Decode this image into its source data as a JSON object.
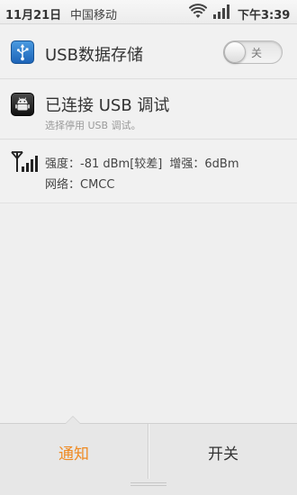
{
  "status_bar": {
    "date": "11月21日",
    "carrier": "中国移动",
    "time": "下午3:39",
    "icons": [
      "wifi-icon",
      "signal-icon"
    ]
  },
  "usb_storage": {
    "title": "USB数据存储",
    "toggle_label": "关",
    "toggle_state": "off",
    "icon": "usb-icon"
  },
  "usb_debug": {
    "title": "已连接 USB 调试",
    "subtitle": "选择停用 USB 调试。",
    "icon": "android-debug-icon"
  },
  "signal": {
    "strength_label": "强度：",
    "strength_value": "-81 dBm[较差]",
    "gain_label": "增强：",
    "gain_value": "6dBm",
    "network_label": "网络：",
    "network_value": "CMCC",
    "icon": "antenna-signal-icon"
  },
  "tabs": [
    {
      "label": "通知",
      "active": true
    },
    {
      "label": "开关",
      "active": false
    }
  ],
  "colors": {
    "active_tab": "#ef8a22",
    "background": "#efefef"
  }
}
